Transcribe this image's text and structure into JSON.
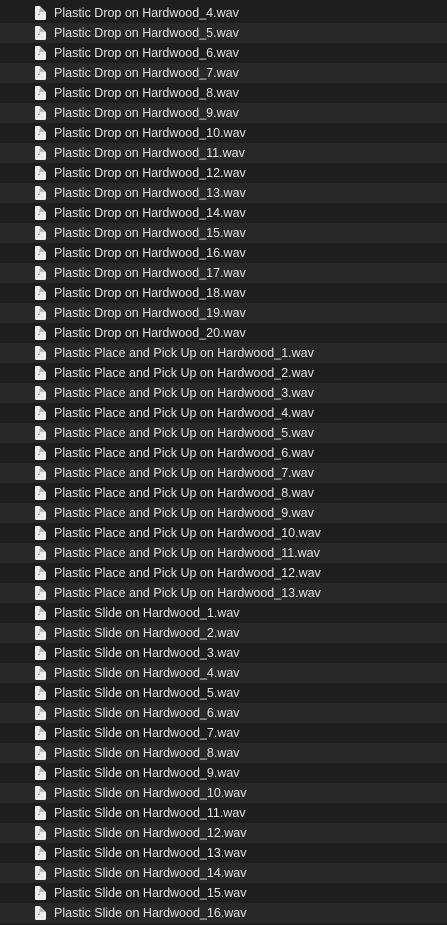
{
  "file_icon": "audio-file-icon",
  "colors": {
    "background": "#1e1e1e",
    "row_alt": "#282828",
    "text": "#e4e4e4"
  },
  "files": [
    "Plastic Drop on Hardwood_4.wav",
    "Plastic Drop on Hardwood_5.wav",
    "Plastic Drop on Hardwood_6.wav",
    "Plastic Drop on Hardwood_7.wav",
    "Plastic Drop on Hardwood_8.wav",
    "Plastic Drop on Hardwood_9.wav",
    "Plastic Drop on Hardwood_10.wav",
    "Plastic Drop on Hardwood_11.wav",
    "Plastic Drop on Hardwood_12.wav",
    "Plastic Drop on Hardwood_13.wav",
    "Plastic Drop on Hardwood_14.wav",
    "Plastic Drop on Hardwood_15.wav",
    "Plastic Drop on Hardwood_16.wav",
    "Plastic Drop on Hardwood_17.wav",
    "Plastic Drop on Hardwood_18.wav",
    "Plastic Drop on Hardwood_19.wav",
    "Plastic Drop on Hardwood_20.wav",
    "Plastic Place and Pick Up on Hardwood_1.wav",
    "Plastic Place and Pick Up on Hardwood_2.wav",
    "Plastic Place and Pick Up on Hardwood_3.wav",
    "Plastic Place and Pick Up on Hardwood_4.wav",
    "Plastic Place and Pick Up on Hardwood_5.wav",
    "Plastic Place and Pick Up on Hardwood_6.wav",
    "Plastic Place and Pick Up on Hardwood_7.wav",
    "Plastic Place and Pick Up on Hardwood_8.wav",
    "Plastic Place and Pick Up on Hardwood_9.wav",
    "Plastic Place and Pick Up on Hardwood_10.wav",
    "Plastic Place and Pick Up on Hardwood_11.wav",
    "Plastic Place and Pick Up on Hardwood_12.wav",
    "Plastic Place and Pick Up on Hardwood_13.wav",
    "Plastic Slide on Hardwood_1.wav",
    "Plastic Slide on Hardwood_2.wav",
    "Plastic Slide on Hardwood_3.wav",
    "Plastic Slide on Hardwood_4.wav",
    "Plastic Slide on Hardwood_5.wav",
    "Plastic Slide on Hardwood_6.wav",
    "Plastic Slide on Hardwood_7.wav",
    "Plastic Slide on Hardwood_8.wav",
    "Plastic Slide on Hardwood_9.wav",
    "Plastic Slide on Hardwood_10.wav",
    "Plastic Slide on Hardwood_11.wav",
    "Plastic Slide on Hardwood_12.wav",
    "Plastic Slide on Hardwood_13.wav",
    "Plastic Slide on Hardwood_14.wav",
    "Plastic Slide on Hardwood_15.wav",
    "Plastic Slide on Hardwood_16.wav"
  ]
}
